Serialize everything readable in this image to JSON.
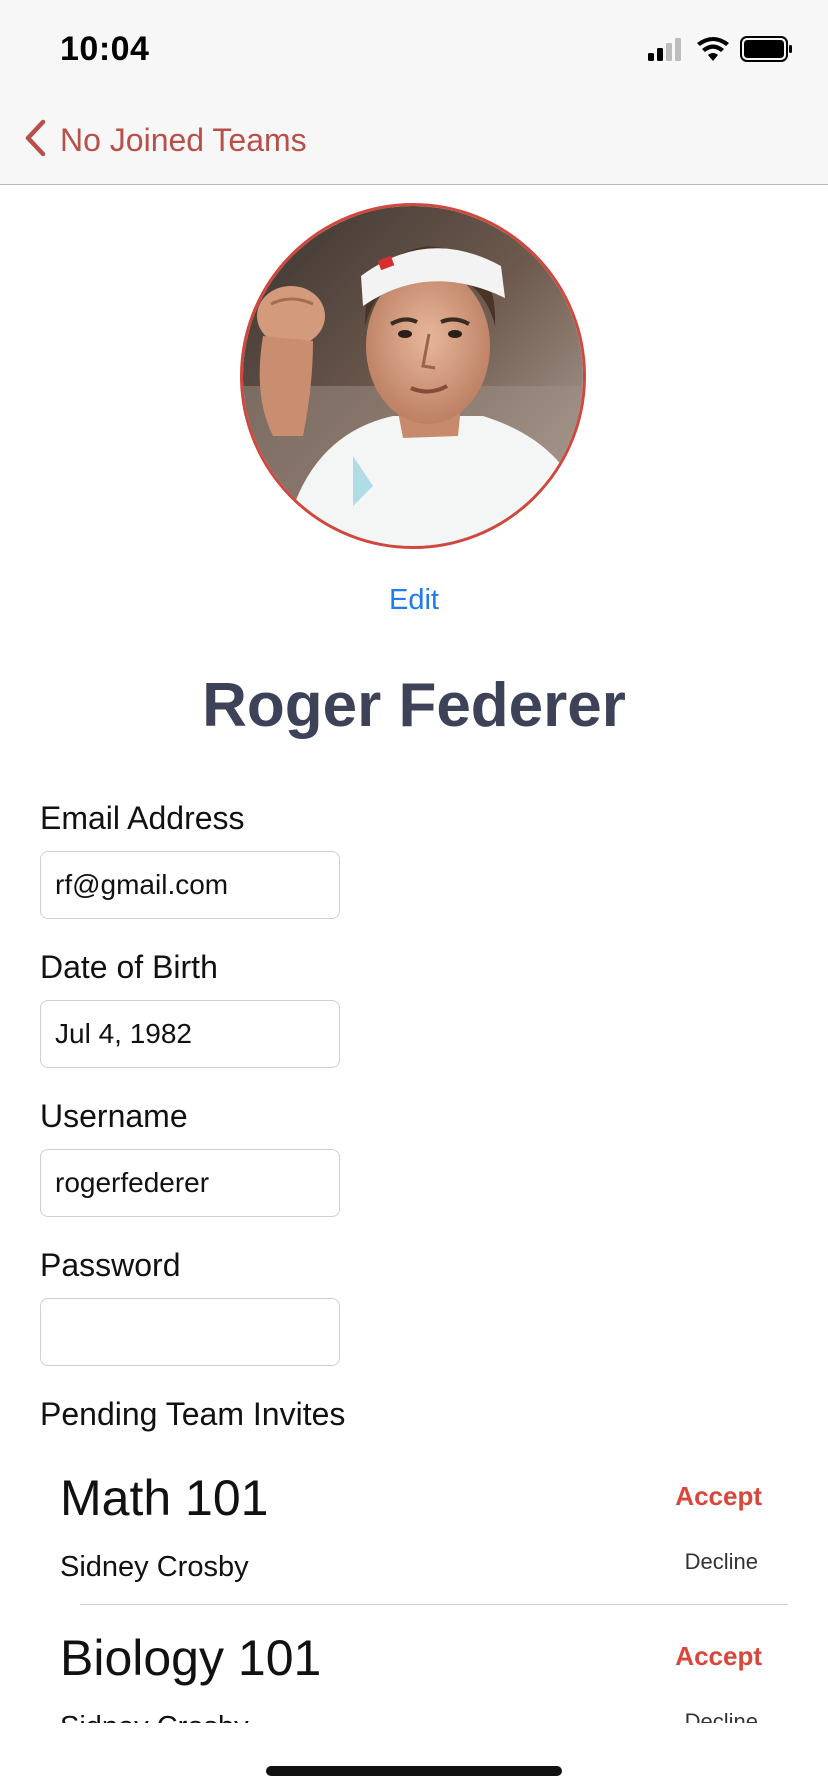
{
  "status_bar": {
    "time": "10:04",
    "icons": [
      "cellular-signal-icon",
      "wifi-icon",
      "battery-icon"
    ]
  },
  "nav": {
    "back_label": "No Joined Teams",
    "back_icon": "chevron-left-icon"
  },
  "profile": {
    "avatar_icon": "profile-photo",
    "edit_label": "Edit",
    "name": "Roger Federer"
  },
  "form": {
    "email": {
      "label": "Email Address",
      "value": "rf@gmail.com"
    },
    "dob": {
      "label": "Date of Birth",
      "value": "Jul 4, 1982"
    },
    "username": {
      "label": "Username",
      "value": "rogerfederer"
    },
    "password": {
      "label": "Password",
      "value": ""
    }
  },
  "invites": {
    "title": "Pending Team Invites",
    "items": [
      {
        "team": "Math 101",
        "owner": "Sidney Crosby",
        "accept": "Accept",
        "decline": "Decline"
      },
      {
        "team": "Biology 101",
        "owner": "Sidney Crosby",
        "accept": "Accept",
        "decline": "Decline"
      }
    ]
  },
  "colors": {
    "accent": "#b8504a",
    "accept": "#d9473c",
    "link": "#1e7cf0",
    "name": "#3d4258"
  }
}
